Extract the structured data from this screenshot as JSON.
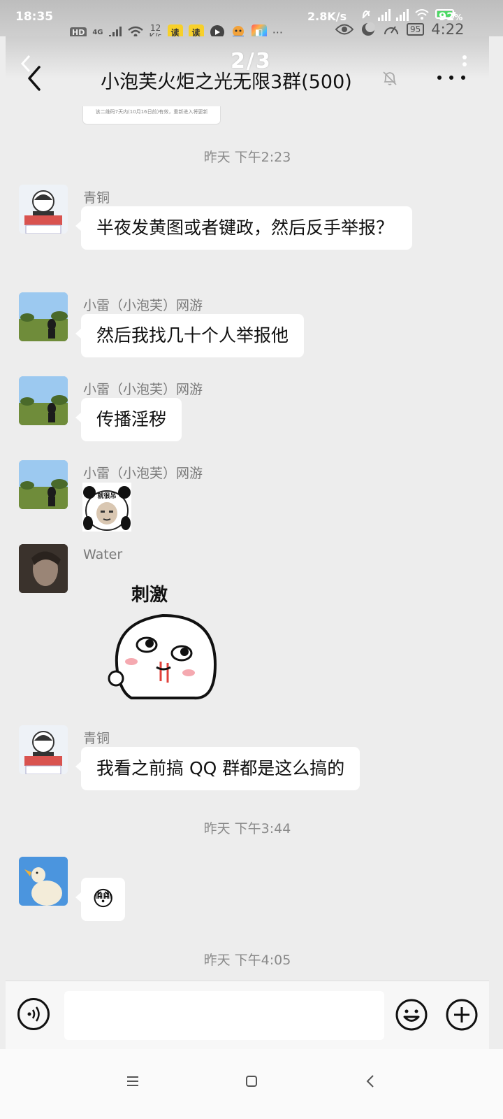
{
  "outer_status": {
    "time": "18:35",
    "network_speed": "2.8K/s",
    "battery": "92"
  },
  "inner_status": {
    "hd": "HD",
    "network": "4G",
    "speed_value": "12",
    "speed_unit": "K/s",
    "app_1": "读",
    "app_2": "读",
    "more": "···",
    "battery": "95",
    "time": "4:22"
  },
  "header": {
    "page_indicator": "2/3",
    "title": "小泡芙火炬之光无限3群(500)"
  },
  "chat": {
    "prev_card_text": "该二维码7天内(10月16日前)有效，重新进入将更新",
    "timestamp_1": "昨天 下午2:23",
    "messages": [
      {
        "sender": "青铜",
        "text": "半夜发黄图或者键政，然后反手举报？"
      },
      {
        "sender": "小雷（小泡芙）网游",
        "text": "然后我找几十个人举报他"
      },
      {
        "sender": "小雷（小泡芙）网游",
        "text": "传播淫秽"
      },
      {
        "sender": "小雷（小泡芙）网游",
        "sticker_caption": "就很吊"
      },
      {
        "sender": "Water",
        "sticker_caption": "刺激"
      },
      {
        "sender": "青铜",
        "text": "我看之前搞 QQ 群都是这么搞的"
      },
      {
        "sender": "",
        "emoji": "😳"
      }
    ],
    "timestamp_2": "昨天 下午3:44",
    "timestamp_3": "昨天 下午4:05"
  },
  "footer": {
    "input_value": ""
  },
  "icons": {
    "back": "back-arrow-icon",
    "mute": "mute-bell-icon",
    "more": "more-icon",
    "voice": "voice-icon",
    "emoji": "emoji-icon",
    "plus": "plus-icon"
  }
}
